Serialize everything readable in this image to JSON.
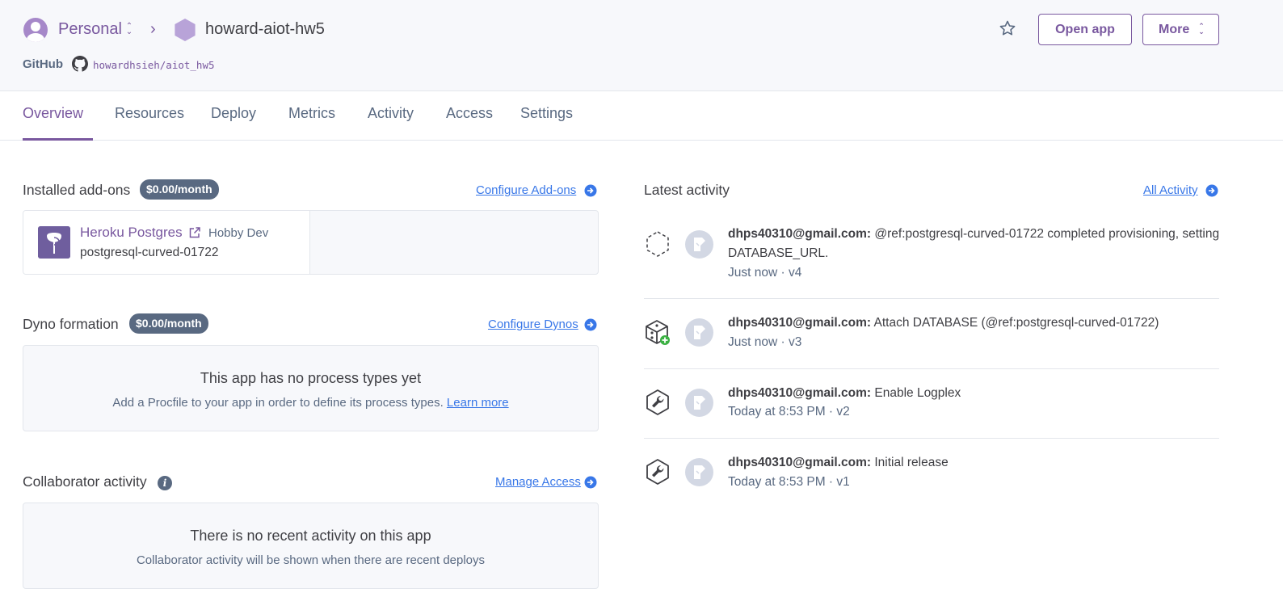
{
  "header": {
    "team": "Personal",
    "app_name": "howard-aiot-hw5",
    "github_label": "GitHub",
    "github_repo": "howardhsieh/aiot_hw5",
    "open_app_label": "Open app",
    "more_label": "More"
  },
  "tabs": [
    {
      "label": "Overview",
      "active": true
    },
    {
      "label": "Resources"
    },
    {
      "label": "Deploy"
    },
    {
      "label": "Metrics"
    },
    {
      "label": "Activity"
    },
    {
      "label": "Access"
    },
    {
      "label": "Settings"
    }
  ],
  "addons": {
    "title": "Installed add-ons",
    "price": "$0.00/month",
    "configure_link": "Configure Add-ons",
    "items": [
      {
        "name": "Heroku Postgres",
        "plan": "Hobby Dev",
        "resource": "postgresql-curved-01722"
      }
    ]
  },
  "dynos": {
    "title": "Dyno formation",
    "price": "$0.00/month",
    "configure_link": "Configure Dynos",
    "empty_title": "This app has no process types yet",
    "empty_sub": "Add a Procfile to your app in order to define its process types.",
    "learn_more": "Learn more"
  },
  "collaborators": {
    "title": "Collaborator activity",
    "manage_link": "Manage Access",
    "empty_title": "There is no recent activity on this app",
    "empty_sub": "Collaborator activity will be shown when there are recent deploys"
  },
  "activity": {
    "title": "Latest activity",
    "all_link": "All Activity",
    "items": [
      {
        "icon": "provisioning-hexagon-icon",
        "user": "dhps40310@gmail.com:",
        "message": "@ref:postgresql-curved-01722 completed provisioning, setting DATABASE_URL.",
        "meta": "Just now · v4"
      },
      {
        "icon": "addon-attach-icon",
        "user": "dhps40310@gmail.com:",
        "message": "Attach DATABASE (@ref:postgresql-curved-01722)",
        "meta": "Just now · v3"
      },
      {
        "icon": "wrench-icon",
        "user": "dhps40310@gmail.com:",
        "message": "Enable Logplex",
        "meta": "Today at 8:53 PM · v2"
      },
      {
        "icon": "wrench-icon",
        "user": "dhps40310@gmail.com:",
        "message": "Initial release",
        "meta": "Today at 8:53 PM · v1"
      }
    ]
  },
  "colors": {
    "accent": "#79589f",
    "link": "#3877e8",
    "muted": "#596981",
    "surface": "#f7f8fb"
  }
}
